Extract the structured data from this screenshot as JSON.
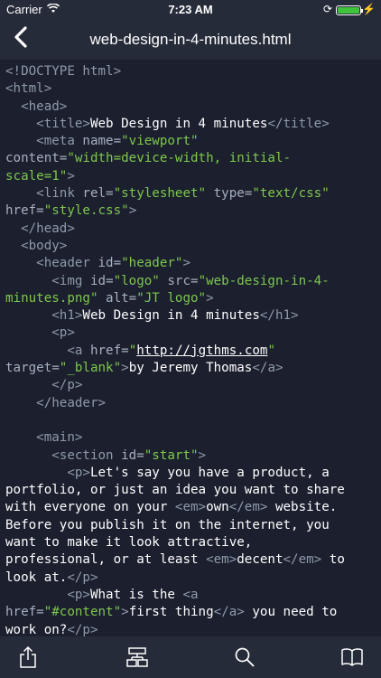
{
  "status_bar": {
    "carrier": "Carrier",
    "time": "7:23 AM"
  },
  "nav": {
    "title": "web-design-in-4-minutes.html"
  },
  "colors": {
    "background": "#1b1f2e",
    "bars": "#262b39",
    "tag": "#8e9aaa",
    "string": "#7ec84c",
    "text": "#ffffff",
    "battery": "#3ec33a"
  },
  "code_lines": [
    [
      [
        "t",
        "<!DOCTYPE html>"
      ]
    ],
    [
      [
        "t",
        "<html>"
      ]
    ],
    [
      [
        "t",
        "  <head>"
      ]
    ],
    [
      [
        "t",
        "    <title>"
      ],
      [
        "txt",
        "Web Design in 4 minutes"
      ],
      [
        "t",
        "</title>"
      ]
    ],
    [
      [
        "t",
        "    <meta "
      ],
      [
        "a",
        "name="
      ],
      [
        "s",
        "\"viewport\""
      ]
    ],
    [
      [
        "a",
        "content="
      ],
      [
        "s",
        "\"width=device-width, initial-"
      ]
    ],
    [
      [
        "s",
        "scale=1\""
      ],
      [
        "t",
        ">"
      ]
    ],
    [
      [
        "t",
        "    <link "
      ],
      [
        "a",
        "rel="
      ],
      [
        "s",
        "\"stylesheet\""
      ],
      [
        "a",
        " type="
      ],
      [
        "s",
        "\"text/css\""
      ]
    ],
    [
      [
        "a",
        "href="
      ],
      [
        "s",
        "\"style.css\""
      ],
      [
        "t",
        ">"
      ]
    ],
    [
      [
        "t",
        "  </head>"
      ]
    ],
    [
      [
        "t",
        "  <body>"
      ]
    ],
    [
      [
        "t",
        "    <header "
      ],
      [
        "a",
        "id="
      ],
      [
        "s",
        "\"header\""
      ],
      [
        "t",
        ">"
      ]
    ],
    [
      [
        "t",
        "      <img "
      ],
      [
        "a",
        "id="
      ],
      [
        "s",
        "\"logo\""
      ],
      [
        "a",
        " src="
      ],
      [
        "s",
        "\"web-design-in-4-"
      ]
    ],
    [
      [
        "s",
        "minutes.png\""
      ],
      [
        "a",
        " alt="
      ],
      [
        "s",
        "\"JT logo\""
      ],
      [
        "t",
        ">"
      ]
    ],
    [
      [
        "t",
        "      <h1>"
      ],
      [
        "txt",
        "Web Design in 4 minutes"
      ],
      [
        "t",
        "</h1>"
      ]
    ],
    [
      [
        "t",
        "      <p>"
      ]
    ],
    [
      [
        "t",
        "        <a "
      ],
      [
        "a",
        "href="
      ],
      [
        "s",
        "\""
      ],
      [
        "link",
        "http://jgthms.com"
      ],
      [
        "s",
        "\""
      ]
    ],
    [
      [
        "a",
        "target="
      ],
      [
        "s",
        "\"_blank\""
      ],
      [
        "t",
        ">"
      ],
      [
        "txt",
        "by Jeremy Thomas"
      ],
      [
        "t",
        "</a>"
      ]
    ],
    [
      [
        "t",
        "      </p>"
      ]
    ],
    [
      [
        "t",
        "    </header>"
      ]
    ],
    [],
    [
      [
        "t",
        "    <main>"
      ]
    ],
    [
      [
        "t",
        "      <section "
      ],
      [
        "a",
        "id="
      ],
      [
        "s",
        "\"start\""
      ],
      [
        "t",
        ">"
      ]
    ],
    [
      [
        "t",
        "        <p>"
      ],
      [
        "txt",
        "Let's say you have a product, a"
      ]
    ],
    [
      [
        "txt",
        "portfolio, or just an idea you want to share"
      ]
    ],
    [
      [
        "txt",
        "with everyone on your "
      ],
      [
        "t",
        "<em>"
      ],
      [
        "txt",
        "own"
      ],
      [
        "t",
        "</em>"
      ],
      [
        "txt",
        " website."
      ]
    ],
    [
      [
        "txt",
        "Before you publish it on the internet, you"
      ]
    ],
    [
      [
        "txt",
        "want to make it look attractive,"
      ]
    ],
    [
      [
        "txt",
        "professional, or at least "
      ],
      [
        "t",
        "<em>"
      ],
      [
        "txt",
        "decent"
      ],
      [
        "t",
        "</em>"
      ],
      [
        "txt",
        " to"
      ]
    ],
    [
      [
        "txt",
        "look at."
      ],
      [
        "t",
        "</p>"
      ]
    ],
    [
      [
        "t",
        "        <p>"
      ],
      [
        "txt",
        "What is the "
      ],
      [
        "t",
        "<a"
      ]
    ],
    [
      [
        "a",
        "href="
      ],
      [
        "s",
        "\"#content\""
      ],
      [
        "t",
        ">"
      ],
      [
        "txt",
        "first thing"
      ],
      [
        "t",
        "</a>"
      ],
      [
        "txt",
        " you need to"
      ]
    ],
    [
      [
        "txt",
        "work on?"
      ],
      [
        "t",
        "</p>"
      ]
    ]
  ],
  "toolbar": {
    "items": [
      "share-icon",
      "structure-icon",
      "search-icon",
      "book-icon"
    ]
  }
}
